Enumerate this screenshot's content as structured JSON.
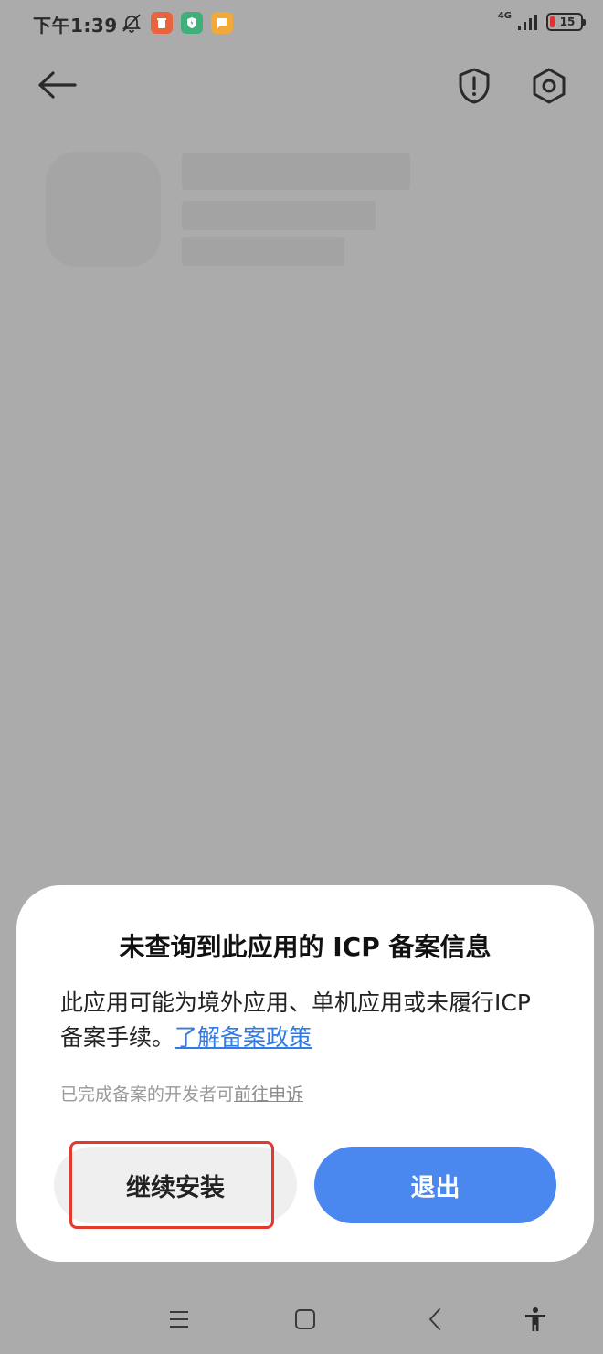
{
  "status_bar": {
    "time": "下午1:39",
    "network": "4G",
    "battery": "15"
  },
  "dialog": {
    "title": "未查询到此应用的 ICP 备案信息",
    "body_text": "此应用可能为境外应用、单机应用或未履行ICP 备案手续。",
    "policy_link": "了解备案政策",
    "note_text": "已完成备案的开发者可",
    "appeal_link": "前往申诉",
    "continue_label": "继续安装",
    "exit_label": "退出"
  },
  "colors": {
    "accent": "#4a88f0",
    "link": "#2f7be8",
    "highlight": "#e23a2e",
    "scrim": "#ababab"
  }
}
